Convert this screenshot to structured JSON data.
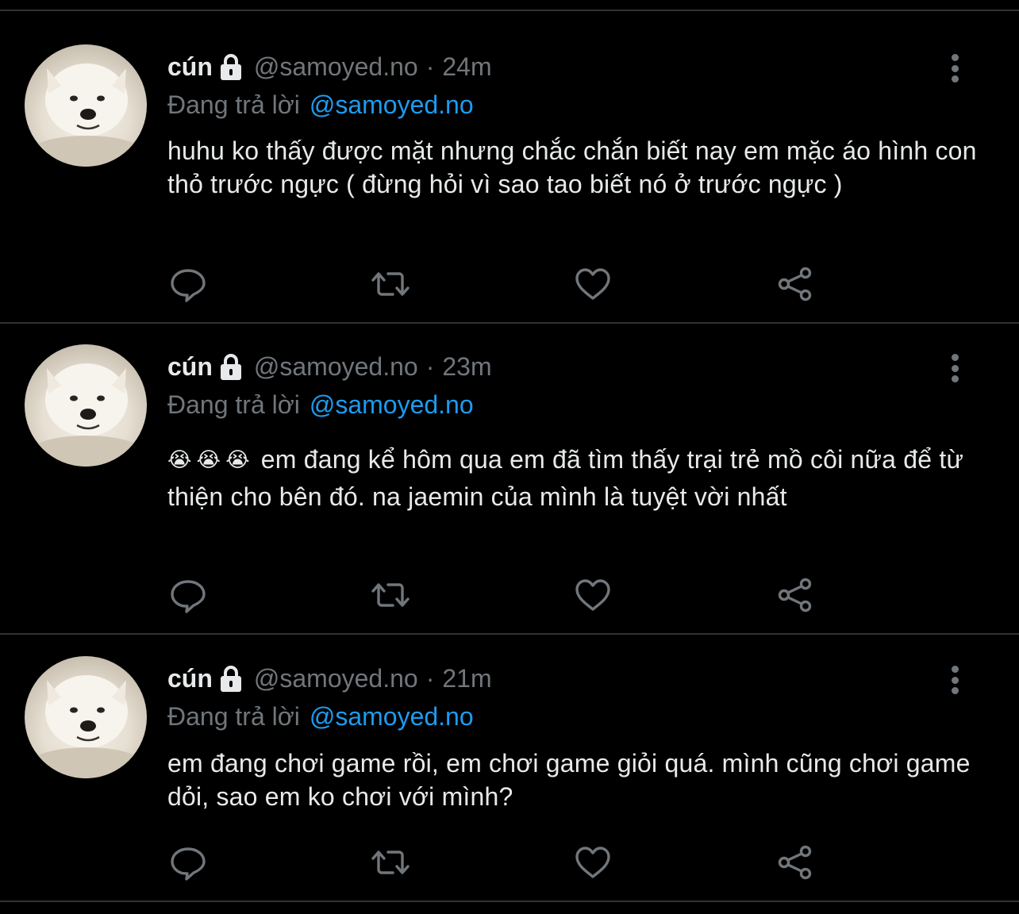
{
  "colors": {
    "background": "#000000",
    "text": "#e7e9ea",
    "muted": "#71767b",
    "accent": "#1d9bf0",
    "divider": "#2f3336"
  },
  "tweets": [
    {
      "name": "cún",
      "handle": "@samoyed.no",
      "separator": "·",
      "time": "24m",
      "reply_prefix": "Đang trả lời",
      "reply_to": "@samoyed.no",
      "emojis": [],
      "text": "huhu ko thấy được mặt nhưng chắc chắn biết nay em mặc áo hình con thỏ trước ngực ( đừng hỏi vì sao tao biết nó ở trước ngực )",
      "icons": [
        "lock-icon",
        "more-icon",
        "reply-icon",
        "retweet-icon",
        "like-icon",
        "share-icon"
      ]
    },
    {
      "name": "cún",
      "handle": "@samoyed.no",
      "separator": "·",
      "time": "23m",
      "reply_prefix": "Đang trả lời",
      "reply_to": "@samoyed.no",
      "emojis": [
        "😭",
        "😭",
        "😭"
      ],
      "text": "em đang kể hôm qua em đã tìm thấy trại trẻ mồ côi nữa để từ thiện cho bên đó. na jaemin của mình là tuyệt vời nhất",
      "icons": [
        "lock-icon",
        "more-icon",
        "reply-icon",
        "retweet-icon",
        "like-icon",
        "share-icon"
      ]
    },
    {
      "name": "cún",
      "handle": "@samoyed.no",
      "separator": "·",
      "time": "21m",
      "reply_prefix": "Đang trả lời",
      "reply_to": "@samoyed.no",
      "emojis": [],
      "text": "em đang chơi game rồi, em chơi game giỏi quá. mình cũng chơi game dỏi, sao em ko chơi với mình?",
      "icons": [
        "lock-icon",
        "more-icon",
        "reply-icon",
        "retweet-icon",
        "like-icon",
        "share-icon"
      ]
    }
  ]
}
